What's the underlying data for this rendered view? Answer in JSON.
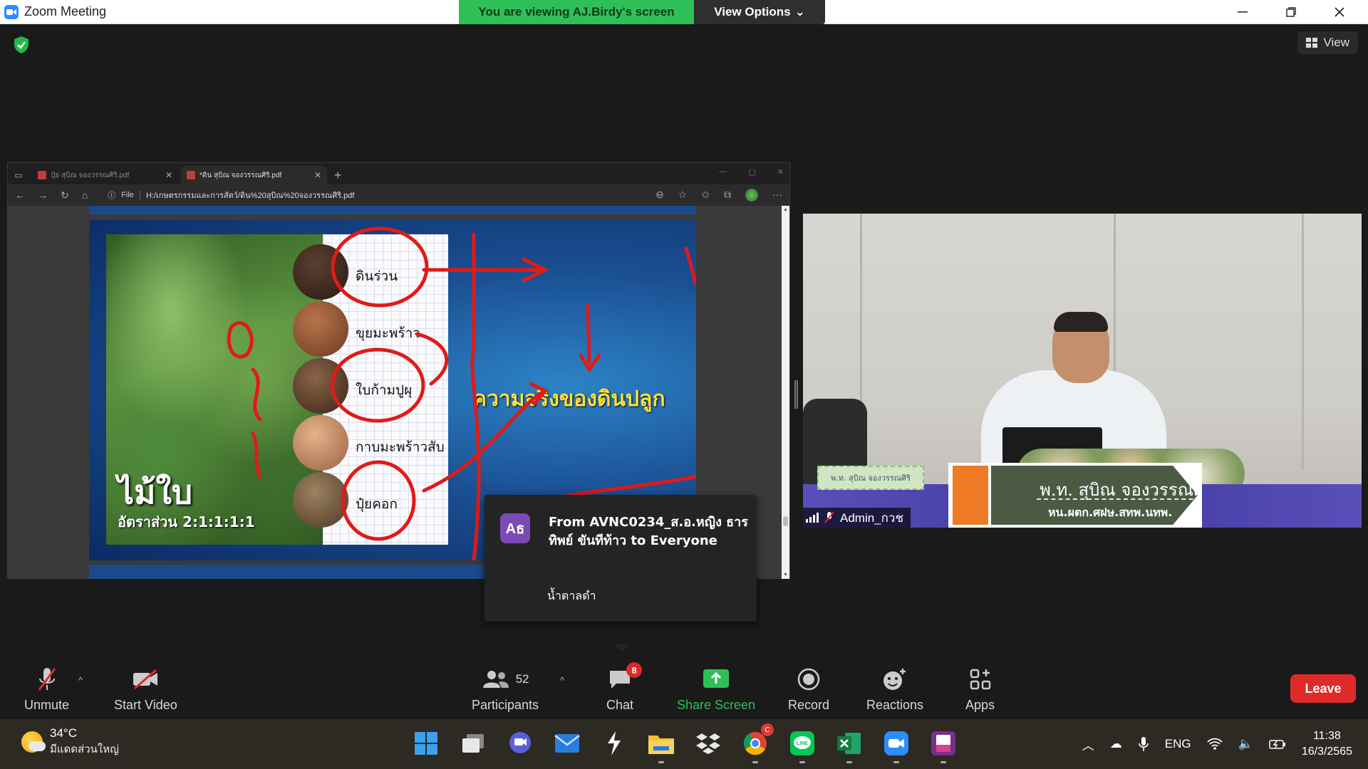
{
  "window": {
    "title": "Zoom Meeting",
    "viewing_banner": "You are viewing AJ.Birdy's screen",
    "view_options_label": "View Options"
  },
  "meeting": {
    "view_label": "View"
  },
  "browser": {
    "tabs": [
      {
        "label": "ปุ๋ย สุบิณ จองวรรณศิริ.pdf",
        "active": false
      },
      {
        "label": "*ดิน สุบิณ จองวรรณศิริ.pdf",
        "active": true
      }
    ],
    "address_prefix": "File",
    "url": "H:/เกษตรกรรมและการสัตว์/ดิน%20สุบิณ%20จองวรรณศิริ.pdf"
  },
  "slide": {
    "title": "ความจริงของดินปลูก",
    "big_text": "ไม้ใบ",
    "ratio_text": "อัตราส่วน 2:1:1:1:1",
    "materials": [
      "ดินร่วน",
      "ขุยมะพร้าว",
      "ใบก้ามปูผุ",
      "กาบมะพร้าวสับ",
      "ปุ๋ยคอก"
    ]
  },
  "video": {
    "participant_label": "Admin_กวช",
    "nameplate_small": "พ.ท. สุบิณ  จองวรรณศิริ",
    "nameplate_name": "พ.ท. สุบิณ  จองวรรณศิริ",
    "nameplate_unit": "หน.ผตก.ศฝษ.สทพ.นทพ."
  },
  "toast": {
    "avatar_initials": "Aธ",
    "from": "From AVNC0234_ส.อ.หญิง ธารทิพย์ ขันทีท้าว to Everyone",
    "message": "น้ำตาลดำ"
  },
  "toolbar": {
    "unmute": "Unmute",
    "start_video": "Start Video",
    "participants": "Participants",
    "participants_count": "52",
    "chat": "Chat",
    "chat_badge": "8",
    "share_screen": "Share Screen",
    "record": "Record",
    "reactions": "Reactions",
    "apps": "Apps",
    "leave": "Leave",
    "accent_green": "#2fbf57",
    "leave_red": "#e02a2a"
  },
  "taskbar": {
    "weather_temp": "34°C",
    "weather_desc": "มีแดดส่วนใหญ่",
    "language": "ENG",
    "time": "11:38",
    "date": "16/3/2565",
    "chrome_badge": "C",
    "apps": [
      "start-icon",
      "task-view-icon",
      "teams-chat-icon",
      "mail-icon",
      "app-icon",
      "file-explorer-icon",
      "dropbox-icon",
      "chrome-icon",
      "line-icon",
      "excel-icon",
      "zoom-icon",
      "pdf-app-icon"
    ]
  }
}
